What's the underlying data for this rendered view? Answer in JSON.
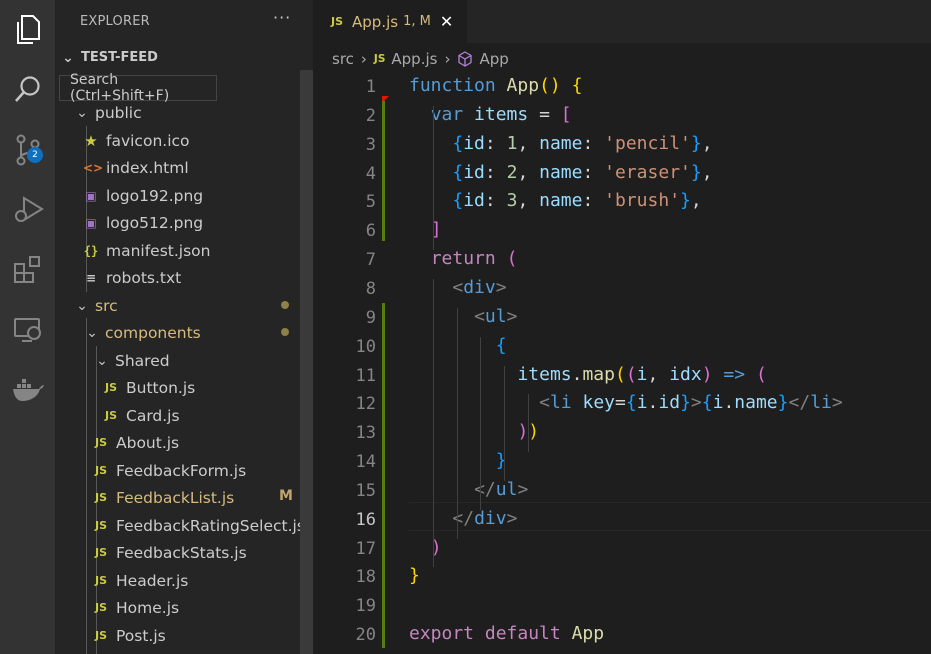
{
  "activity_bar": {
    "items": [
      "explorer-icon",
      "search-icon",
      "source-control-icon",
      "run-debug-icon",
      "extensions-icon",
      "remote-explorer-icon",
      "docker-icon"
    ],
    "source_control_badge": "2"
  },
  "sidebar": {
    "title": "EXPLORER",
    "more": "···",
    "tooltip": "Search (Ctrl+Shift+F)",
    "tree": [
      {
        "label": "TEST-FEED",
        "kind": "root",
        "expanded": true
      },
      {
        "label": "public",
        "kind": "folder",
        "expanded": true
      },
      {
        "label": "favicon.ico",
        "icon": "star-icon"
      },
      {
        "label": "index.html",
        "icon": "html-icon"
      },
      {
        "label": "logo192.png",
        "icon": "image-icon"
      },
      {
        "label": "logo512.png",
        "icon": "image-icon"
      },
      {
        "label": "manifest.json",
        "icon": "json-icon"
      },
      {
        "label": "robots.txt",
        "icon": "text-file-icon"
      },
      {
        "label": "src",
        "kind": "folder",
        "expanded": true,
        "modified_dot": true
      },
      {
        "label": "components",
        "kind": "folder",
        "expanded": true,
        "modified_dot": true
      },
      {
        "label": "Shared",
        "kind": "folder",
        "expanded": true
      },
      {
        "label": "Button.js",
        "icon": "js-icon"
      },
      {
        "label": "Card.js",
        "icon": "js-icon"
      },
      {
        "label": "About.js",
        "icon": "js-icon"
      },
      {
        "label": "FeedbackForm.js",
        "icon": "js-icon"
      },
      {
        "label": "FeedbackList.js",
        "icon": "js-icon",
        "modified": true,
        "badge": "M"
      },
      {
        "label": "FeedbackRatingSelect.js",
        "icon": "js-icon"
      },
      {
        "label": "FeedbackStats.js",
        "icon": "js-icon"
      },
      {
        "label": "Header.js",
        "icon": "js-icon"
      },
      {
        "label": "Home.js",
        "icon": "js-icon"
      },
      {
        "label": "Post.js",
        "icon": "js-icon"
      }
    ]
  },
  "editor": {
    "tab": {
      "file_icon": "JS",
      "name": "App.js",
      "status": "1, M",
      "close": "✕"
    },
    "breadcrumb": [
      "src",
      "App.js",
      "App"
    ],
    "breadcrumb_icon": "JS",
    "sep": "›",
    "active_line": 16,
    "lines": [
      "function App() {",
      "  var items = [",
      "    {id: 1, name: 'pencil'},",
      "    {id: 2, name: 'eraser'},",
      "    {id: 3, name: 'brush'},",
      "  ]",
      "  return (",
      "    <div>",
      "      <ul>",
      "        {",
      "          items.map((i, idx) => (",
      "            <li key={i.id}>{i.name}</li>",
      "          ))",
      "        }",
      "      </ul>",
      "    </div>",
      "  )",
      "}",
      "",
      "export default App"
    ]
  },
  "colors": {
    "activity_bg": "#333333",
    "sidebar_bg": "#252526",
    "editor_bg": "#1e1e1e",
    "keyword": "#569cd6",
    "function": "#dcdcaa",
    "variable": "#9cdcfe",
    "string": "#ce9178",
    "number": "#b5cea8",
    "modified": "#d7ba7d",
    "gutter_added": "#587c0c"
  }
}
